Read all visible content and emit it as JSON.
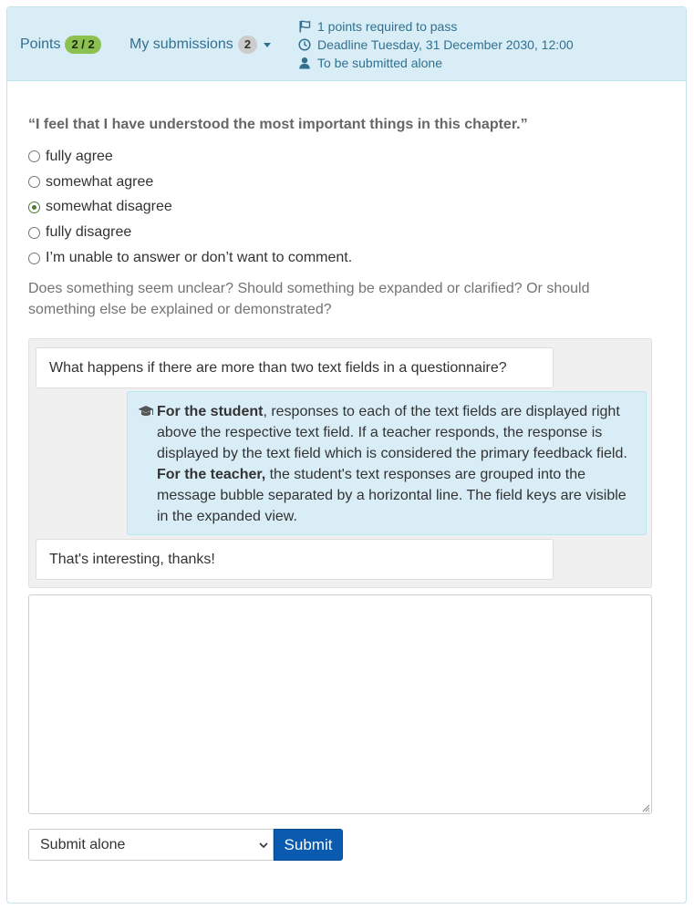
{
  "header": {
    "points_label": "Points",
    "points_value": "2 / 2",
    "submissions_label": "My submissions",
    "submissions_count": "2",
    "meta": {
      "required": "1 points required to pass",
      "deadline": "Deadline Tuesday, 31 December 2030, 12:00",
      "submit_mode": "To be submitted alone"
    }
  },
  "question": {
    "text": "“I feel that I have understood the most important things in this chapter.”",
    "options": [
      {
        "label": "fully agree",
        "checked": false
      },
      {
        "label": "somewhat agree",
        "checked": false
      },
      {
        "label": "somewhat disagree",
        "checked": true
      },
      {
        "label": "fully disagree",
        "checked": false
      },
      {
        "label": "I’m unable to answer or don’t want to comment.",
        "checked": false
      }
    ]
  },
  "help_text": "Does something seem unclear? Should something be expanded or clarified? Or should something else be explained or demonstrated?",
  "thread": {
    "student_message_1": "What happens if there are more than two text fields in a questionnaire?",
    "teacher_reply": {
      "bold_1": "For the student",
      "text_1": ", responses to each of the text fields are displayed right above the respective text field. If a teacher responds, the response is displayed by the text field which is considered the primary feedback field.",
      "bold_2": "For the teacher,",
      "text_2": " the student's text responses are grouped into the message bubble separated by a horizontal line. The field keys are visible in the expanded view."
    },
    "student_message_2": "That's interesting, thanks!"
  },
  "form": {
    "textarea_value": "",
    "select_value": "Submit alone",
    "submit_label": "Submit"
  },
  "colors": {
    "header_bg": "#d9edf7",
    "link": "#31708f",
    "points_badge": "#8cc152",
    "submit_bg": "#0a5bb0"
  }
}
